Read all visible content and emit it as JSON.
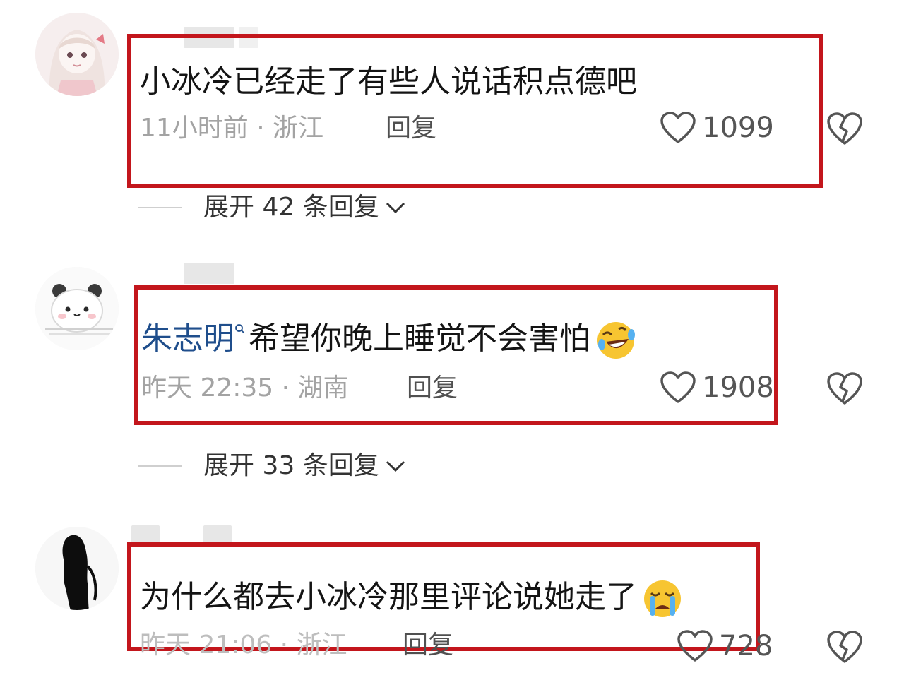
{
  "comments": [
    {
      "text": "小冰冷已经走了有些人说话积点德吧",
      "time_location": "11小时前 · 浙江",
      "reply_label": "回复",
      "like_count": "1099",
      "expand_label": "展开 42 条回复"
    },
    {
      "mention": "朱志明",
      "text": "希望你晚上睡觉不会害怕",
      "emoji_icon": "rolling-on-floor-laughing-emoji",
      "time_location": "昨天 22:35 · 湖南",
      "reply_label": "回复",
      "like_count": "1908",
      "expand_label": "展开 33 条回复"
    },
    {
      "text": "为什么都去小冰冷那里评论说她走了",
      "emoji_icon": "loudly-crying-emoji",
      "time_location": "昨天 21:06 · 浙江",
      "reply_label": "回复",
      "like_count": "728"
    }
  ],
  "icons": {
    "like": "heart-outline-icon",
    "dislike": "broken-heart-icon",
    "expand": "chevron-down-icon"
  },
  "colors": {
    "highlight_border": "#c3161c",
    "mention": "#1f4e8c",
    "meta": "#a3a3a3"
  }
}
